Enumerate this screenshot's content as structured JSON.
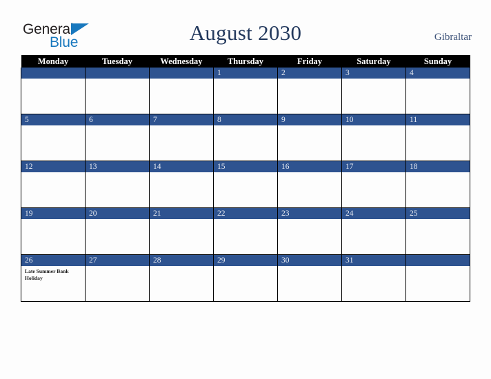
{
  "brand": {
    "name_part1": "General",
    "name_part2": "Blue",
    "triangle_color": "#1878be",
    "text_color": "#231f20"
  },
  "header": {
    "title": "August 2030",
    "country": "Gibraltar",
    "title_color": "#23395d",
    "country_color": "#3d5379"
  },
  "calendar": {
    "weekday_headers": [
      "Monday",
      "Tuesday",
      "Wednesday",
      "Thursday",
      "Friday",
      "Saturday",
      "Sunday"
    ],
    "header_bg": "#000000",
    "header_text": "#ffffff",
    "daybar_bg": "#2e5390",
    "daybar_text": "#e8ebf2",
    "weeks": [
      [
        {
          "day": ""
        },
        {
          "day": ""
        },
        {
          "day": ""
        },
        {
          "day": "1"
        },
        {
          "day": "2"
        },
        {
          "day": "3"
        },
        {
          "day": "4"
        }
      ],
      [
        {
          "day": "5"
        },
        {
          "day": "6"
        },
        {
          "day": "7"
        },
        {
          "day": "8"
        },
        {
          "day": "9"
        },
        {
          "day": "10"
        },
        {
          "day": "11"
        }
      ],
      [
        {
          "day": "12"
        },
        {
          "day": "13"
        },
        {
          "day": "14"
        },
        {
          "day": "15"
        },
        {
          "day": "16"
        },
        {
          "day": "17"
        },
        {
          "day": "18"
        }
      ],
      [
        {
          "day": "19"
        },
        {
          "day": "20"
        },
        {
          "day": "21"
        },
        {
          "day": "22"
        },
        {
          "day": "23"
        },
        {
          "day": "24"
        },
        {
          "day": "25"
        }
      ],
      [
        {
          "day": "26",
          "events": [
            "Late Summer Bank Holiday"
          ]
        },
        {
          "day": "27"
        },
        {
          "day": "28"
        },
        {
          "day": "29"
        },
        {
          "day": "30"
        },
        {
          "day": "31"
        },
        {
          "day": ""
        }
      ]
    ]
  }
}
